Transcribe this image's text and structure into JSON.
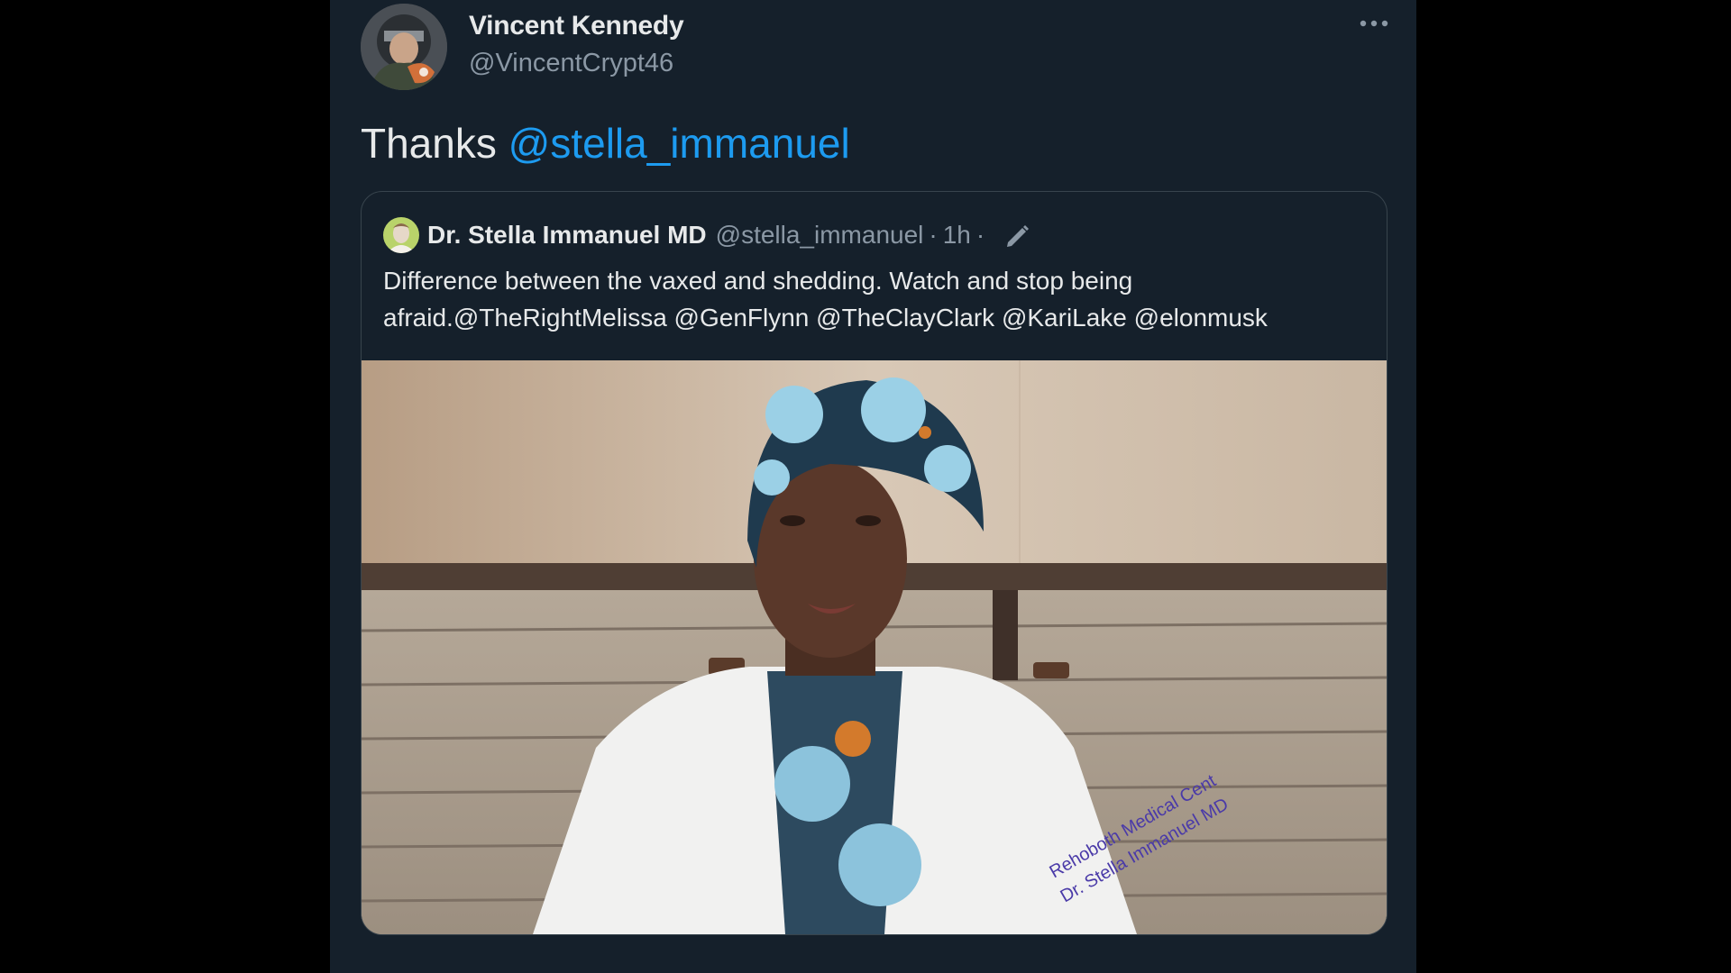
{
  "tweet": {
    "author_name": "Vincent Kennedy",
    "author_handle": "@VincentCrypt46",
    "more_icon": "more-horizontal-icon",
    "text_prefix": "Thanks ",
    "mention": "@stella_immanuel"
  },
  "quote": {
    "name": "Dr. Stella Immanuel MD",
    "handle": "@stella_immanuel",
    "separator": "·",
    "time": "1h",
    "edit_icon": "pencil-edit-icon",
    "text_line1": "Difference between the vaxed and shedding. Watch and stop being",
    "text_line2": "afraid.@TheRightMelissa @GenFlynn @TheClayClark @KariLake @elonmusk",
    "media": {
      "coat_text_line1": "Rehoboth Medical Cent",
      "coat_text_line2": "Dr. Stella Immanuel MD"
    }
  },
  "colors": {
    "background": "#000000",
    "tweet_bg": "#15202b",
    "text": "#e7e9ea",
    "secondary_text": "#8b98a5",
    "link": "#1d9bf0",
    "border": "#38444d"
  }
}
